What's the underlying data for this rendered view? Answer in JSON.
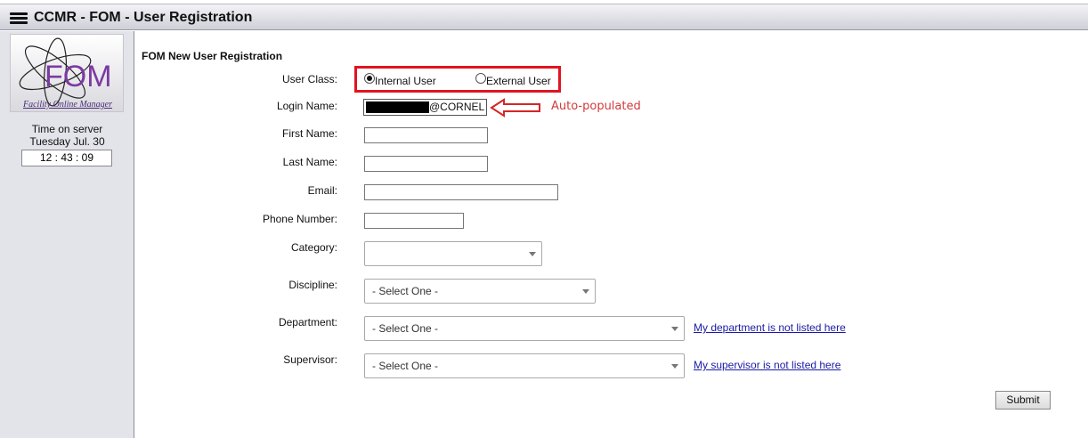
{
  "header": {
    "title": "CCMR - FOM - User Registration"
  },
  "sidebar": {
    "logo_text": "FOM",
    "logo_caption": "Facility Online Manager",
    "time_label": "Time on server",
    "time_date": "Tuesday Jul. 30",
    "time_value": "12 : 43 : 09"
  },
  "form": {
    "title": "FOM New User Registration",
    "user_class": {
      "label": "User Class:",
      "options": [
        {
          "label": "Internal User",
          "selected": true
        },
        {
          "label": "External User",
          "selected": false
        }
      ]
    },
    "login_name": {
      "label": "Login Name:",
      "suffix": "@CORNEL"
    },
    "first_name": {
      "label": "First Name:",
      "value": ""
    },
    "last_name": {
      "label": "Last Name:",
      "value": ""
    },
    "email": {
      "label": "Email:",
      "value": ""
    },
    "phone": {
      "label": "Phone Number:",
      "value": ""
    },
    "category": {
      "label": "Category:",
      "value": ""
    },
    "discipline": {
      "label": "Discipline:",
      "value": "- Select One -"
    },
    "department": {
      "label": "Department:",
      "value": "- Select One -",
      "link": "My department is not listed here"
    },
    "supervisor": {
      "label": "Supervisor:",
      "value": "- Select One -",
      "link": "My supervisor is not listed here"
    },
    "submit_label": "Submit"
  },
  "annotation": {
    "text": "Auto-populated",
    "color": "#d23b3b",
    "highlight_color": "#e1141f"
  }
}
